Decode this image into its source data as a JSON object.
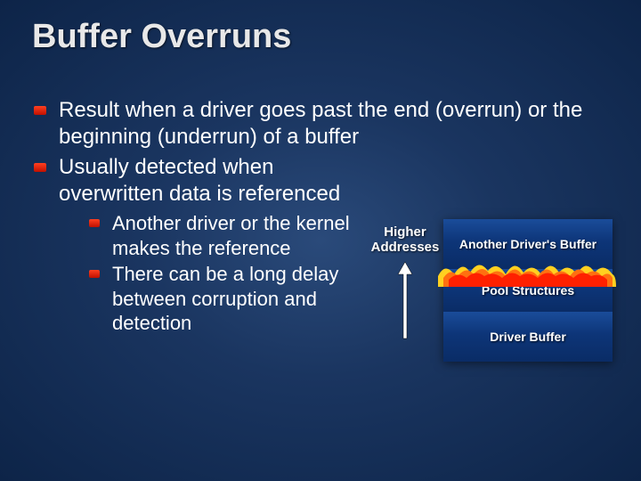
{
  "title": "Buffer Overruns",
  "bullets": [
    "Result when a driver goes past the end (overrun) or the beginning (underrun) of a buffer",
    "Usually detected when overwritten data is referenced"
  ],
  "sub_bullets": [
    "Another driver or the kernel makes the reference",
    "There can be a long delay between corruption and detection"
  ],
  "diagram": {
    "arrow_label_top": "Higher",
    "arrow_label_bottom": "Addresses",
    "boxes": [
      "Another Driver's Buffer",
      "Pool Structures",
      "Driver Buffer"
    ]
  },
  "colors": {
    "bullet": "#e02000",
    "box_gradient_top": "#1a4c9a",
    "box_gradient_bottom": "#0a2c66",
    "splash_outer": "#ffd020",
    "splash_inner": "#ff3000"
  }
}
